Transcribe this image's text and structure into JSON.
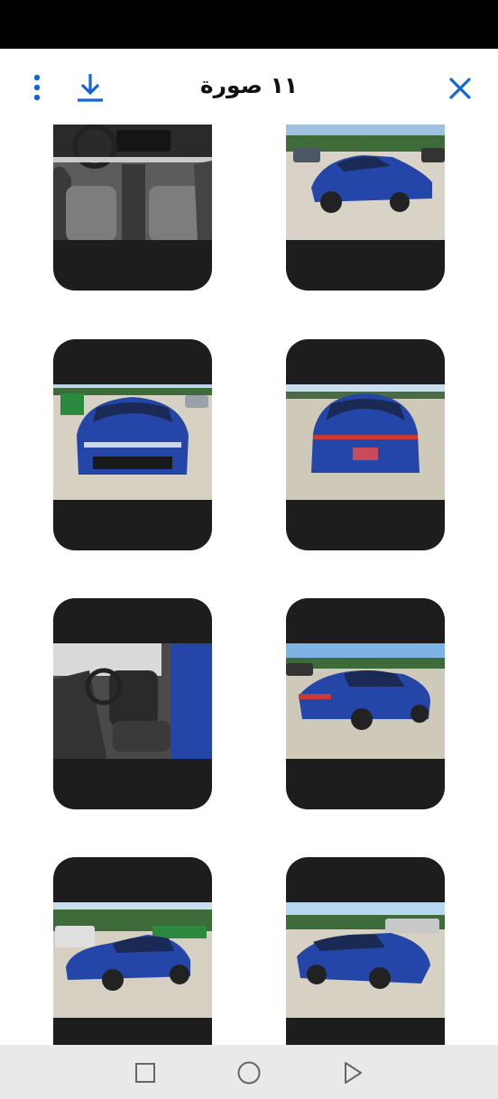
{
  "header": {
    "title": "١١ صورة",
    "close_icon": "close-icon",
    "download_icon": "download-icon",
    "more_icon": "more-vertical-icon"
  },
  "colors": {
    "accent": "#1565d8",
    "card_bg": "#1d1d1d",
    "car_blue": "#2346a8"
  },
  "photos": [
    {
      "subject": "interior-dashboard"
    },
    {
      "subject": "front-left-exterior"
    },
    {
      "subject": "front-exterior"
    },
    {
      "subject": "rear-exterior"
    },
    {
      "subject": "driver-door-interior"
    },
    {
      "subject": "rear-left-exterior"
    },
    {
      "subject": "left-side-exterior"
    },
    {
      "subject": "rear-damage-exterior"
    }
  ],
  "nav": {
    "recent_icon": "square-icon",
    "home_icon": "circle-icon",
    "back_icon": "triangle-back-icon"
  }
}
